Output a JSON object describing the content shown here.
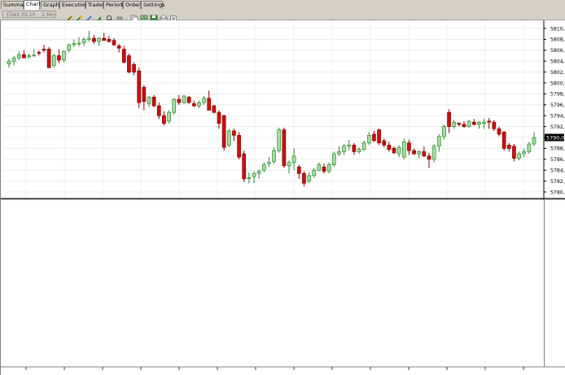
{
  "tabs": [
    {
      "label": "Summary",
      "active": false
    },
    {
      "label": "Chart",
      "active": true
    },
    {
      "label": "Graphs",
      "active": false
    },
    {
      "label": "Executions",
      "active": false
    },
    {
      "label": "Trades",
      "active": false
    },
    {
      "label": "Periods",
      "active": false
    },
    {
      "label": "Orders",
      "active": false
    },
    {
      "label": "Settings",
      "active": false
    }
  ],
  "toolbar": {
    "instrument": "FDAX 03-10",
    "interval": "1 Min",
    "icons": [
      "pencil-icon",
      "brush-icon",
      "zoom-icon",
      "grid-icon",
      "copy-icon",
      "save-icon",
      "print-icon",
      "settings-icon"
    ]
  },
  "colors": {
    "up_fill": "#ffffff",
    "up_border": "#2e8b2e",
    "up_body": "#a4dda4",
    "down_fill": "#cc1010",
    "down_border": "#8b0000",
    "grid": "#ececec",
    "axis": "#000000"
  },
  "chart_data": {
    "type": "candlestick",
    "title": "",
    "ylim": [
      5778,
      5812
    ],
    "y_ticks": [
      "5810,0",
      "5808,0",
      "5806,0",
      "5804,0",
      "5802,0",
      "5800,0",
      "5798,0",
      "5796,0",
      "5794,0",
      "5792,0",
      "5790,0",
      "5788,0",
      "5786,0",
      "5784,0",
      "5782,0",
      "5780,0"
    ],
    "y_tick_values": [
      5810,
      5808,
      5806,
      5804,
      5802,
      5800,
      5798,
      5796,
      5794,
      5792,
      5790,
      5788,
      5786,
      5784,
      5782,
      5780
    ],
    "last_price_label": "5790,0",
    "last_price": 5790,
    "candles": [
      [
        5803.5,
        5804.5,
        5802.8,
        5804.0
      ],
      [
        5804.0,
        5805.0,
        5803.2,
        5804.6
      ],
      [
        5804.6,
        5805.8,
        5804.2,
        5805.2
      ],
      [
        5805.2,
        5806.0,
        5804.8,
        5804.6
      ],
      [
        5804.8,
        5805.4,
        5804.4,
        5805.0
      ],
      [
        5805.0,
        5806.2,
        5804.8,
        5805.1
      ],
      [
        5805.6,
        5806.0,
        5805.0,
        5805.5
      ],
      [
        5806.2,
        5807.0,
        5805.6,
        5806.0
      ],
      [
        5806.2,
        5806.6,
        5805.2,
        5802.8
      ],
      [
        5803.2,
        5805.4,
        5802.8,
        5805.0
      ],
      [
        5805.0,
        5806.2,
        5803.6,
        5804.2
      ],
      [
        5804.2,
        5806.0,
        5803.8,
        5805.8
      ],
      [
        5806.0,
        5807.2,
        5805.6,
        5807.0
      ],
      [
        5807.1,
        5808.0,
        5806.6,
        5807.2
      ],
      [
        5807.2,
        5808.4,
        5806.8,
        5807.3
      ],
      [
        5807.4,
        5808.4,
        5806.8,
        5808.0
      ],
      [
        5808.0,
        5809.6,
        5807.6,
        5808.2
      ],
      [
        5808.2,
        5808.8,
        5807.2,
        5807.6
      ],
      [
        5807.6,
        5808.4,
        5806.8,
        5808.2
      ],
      [
        5808.2,
        5809.2,
        5807.8,
        5807.8
      ],
      [
        5808.0,
        5808.6,
        5807.4,
        5807.6
      ],
      [
        5807.8,
        5808.2,
        5806.8,
        5807.0
      ],
      [
        5806.8,
        5807.2,
        5805.6,
        5806.4
      ],
      [
        5806.2,
        5806.8,
        5803.6,
        5803.8
      ],
      [
        5805.0,
        5805.4,
        5801.8,
        5802.0
      ],
      [
        5803.4,
        5803.8,
        5801.4,
        5802.0
      ],
      [
        5802.2,
        5802.8,
        5795.4,
        5796.4
      ],
      [
        5799.2,
        5799.6,
        5795.0,
        5796.6
      ],
      [
        5796.2,
        5797.6,
        5795.6,
        5797.4
      ],
      [
        5797.4,
        5797.8,
        5795.6,
        5795.8
      ],
      [
        5795.8,
        5796.4,
        5793.4,
        5794.0
      ],
      [
        5794.0,
        5794.8,
        5792.2,
        5792.6
      ],
      [
        5793.0,
        5795.0,
        5792.6,
        5794.6
      ],
      [
        5794.6,
        5797.2,
        5794.2,
        5797.0
      ],
      [
        5797.0,
        5797.8,
        5796.0,
        5796.4
      ],
      [
        5796.4,
        5797.8,
        5796.2,
        5797.6
      ],
      [
        5797.4,
        5797.6,
        5796.2,
        5796.4
      ],
      [
        5796.2,
        5796.8,
        5795.6,
        5795.8
      ],
      [
        5795.8,
        5796.8,
        5795.4,
        5796.4
      ],
      [
        5796.4,
        5797.6,
        5796.0,
        5797.2
      ],
      [
        5797.2,
        5798.6,
        5796.8,
        5795.0
      ],
      [
        5795.8,
        5796.0,
        5794.4,
        5794.6
      ],
      [
        5794.6,
        5795.0,
        5791.6,
        5792.6
      ],
      [
        5794.0,
        5794.2,
        5787.6,
        5788.2
      ],
      [
        5788.6,
        5791.6,
        5788.2,
        5791.2
      ],
      [
        5791.2,
        5791.6,
        5789.4,
        5790.4
      ],
      [
        5790.4,
        5791.0,
        5786.0,
        5786.4
      ],
      [
        5787.0,
        5787.6,
        5781.8,
        5782.4
      ],
      [
        5782.6,
        5783.6,
        5781.6,
        5782.6
      ],
      [
        5782.8,
        5783.8,
        5781.6,
        5783.4
      ],
      [
        5783.4,
        5784.2,
        5782.4,
        5783.8
      ],
      [
        5784.0,
        5785.4,
        5783.6,
        5785.0
      ],
      [
        5785.2,
        5786.4,
        5784.6,
        5785.4
      ],
      [
        5785.6,
        5788.2,
        5785.2,
        5787.6
      ],
      [
        5787.6,
        5791.8,
        5787.2,
        5791.4
      ],
      [
        5791.4,
        5791.8,
        5784.4,
        5784.8
      ],
      [
        5784.8,
        5785.8,
        5783.4,
        5785.4
      ],
      [
        5785.4,
        5788.0,
        5784.0,
        5786.6
      ],
      [
        5784.6,
        5785.0,
        5782.4,
        5783.4
      ],
      [
        5783.4,
        5783.8,
        5781.0,
        5781.6
      ],
      [
        5782.0,
        5783.6,
        5781.6,
        5783.0
      ],
      [
        5783.0,
        5784.4,
        5782.6,
        5784.0
      ],
      [
        5784.0,
        5785.4,
        5783.8,
        5785.0
      ],
      [
        5784.6,
        5785.2,
        5783.4,
        5783.8
      ],
      [
        5783.8,
        5785.4,
        5783.4,
        5785.0
      ],
      [
        5785.0,
        5787.4,
        5784.6,
        5787.0
      ],
      [
        5787.0,
        5788.4,
        5786.6,
        5787.4
      ],
      [
        5787.4,
        5788.8,
        5786.8,
        5788.4
      ],
      [
        5788.4,
        5789.6,
        5787.6,
        5788.6
      ],
      [
        5788.6,
        5789.0,
        5786.8,
        5787.4
      ],
      [
        5787.4,
        5788.2,
        5787.0,
        5787.8
      ],
      [
        5787.8,
        5789.4,
        5787.6,
        5789.0
      ],
      [
        5789.0,
        5791.0,
        5788.6,
        5790.4
      ],
      [
        5790.6,
        5791.2,
        5789.2,
        5789.4
      ],
      [
        5791.4,
        5791.6,
        5788.6,
        5789.0
      ],
      [
        5789.4,
        5789.8,
        5788.2,
        5788.6
      ],
      [
        5788.6,
        5789.2,
        5787.4,
        5787.8
      ],
      [
        5788.0,
        5788.4,
        5787.0,
        5787.2
      ],
      [
        5787.0,
        5788.6,
        5786.4,
        5788.2
      ],
      [
        5786.4,
        5789.8,
        5786.0,
        5789.2
      ],
      [
        5789.0,
        5789.6,
        5786.8,
        5787.6
      ],
      [
        5787.6,
        5788.0,
        5786.8,
        5787.0
      ],
      [
        5787.0,
        5787.6,
        5786.2,
        5787.4
      ],
      [
        5787.4,
        5788.4,
        5786.4,
        5786.6
      ],
      [
        5786.6,
        5787.2,
        5784.4,
        5786.0
      ],
      [
        5786.0,
        5788.8,
        5785.4,
        5788.4
      ],
      [
        5788.4,
        5790.6,
        5787.4,
        5790.2
      ],
      [
        5790.2,
        5792.4,
        5789.6,
        5792.0
      ],
      [
        5794.6,
        5795.2,
        5790.8,
        5792.0
      ],
      [
        5792.0,
        5793.2,
        5791.6,
        5792.8
      ],
      [
        5792.6,
        5792.8,
        5792.0,
        5792.4
      ],
      [
        5792.4,
        5793.0,
        5791.8,
        5792.0
      ],
      [
        5792.0,
        5793.2,
        5791.8,
        5793.0
      ],
      [
        5792.8,
        5793.4,
        5792.2,
        5792.4
      ],
      [
        5792.4,
        5793.0,
        5791.6,
        5792.8
      ],
      [
        5792.6,
        5793.4,
        5791.6,
        5792.8
      ],
      [
        5793.0,
        5793.6,
        5791.6,
        5792.8
      ],
      [
        5792.8,
        5793.2,
        5791.2,
        5791.6
      ],
      [
        5791.6,
        5792.0,
        5790.2,
        5790.6
      ],
      [
        5791.0,
        5791.2,
        5787.6,
        5788.0
      ],
      [
        5788.6,
        5789.0,
        5787.4,
        5788.0
      ],
      [
        5788.4,
        5788.8,
        5785.6,
        5786.2
      ],
      [
        5786.2,
        5787.4,
        5785.8,
        5787.0
      ],
      [
        5787.0,
        5788.0,
        5786.4,
        5787.4
      ],
      [
        5787.4,
        5789.2,
        5787.0,
        5788.8
      ],
      [
        5788.8,
        5791.0,
        5788.4,
        5790.0
      ]
    ]
  }
}
